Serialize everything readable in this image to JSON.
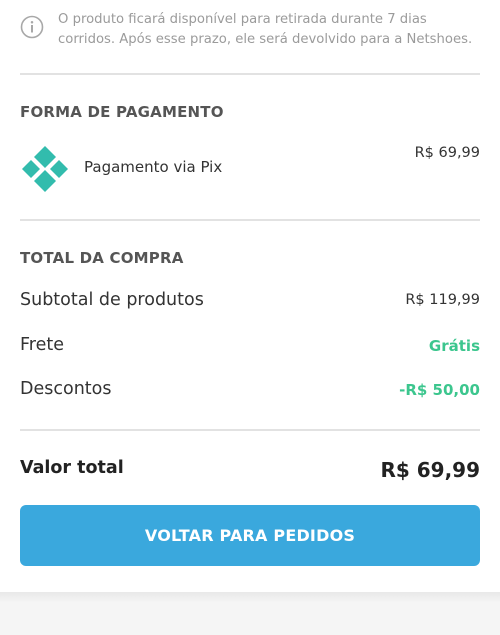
{
  "notice": {
    "icon": "info-icon",
    "text": "O produto ficará disponível para retirada durante 7 dias corridos. Após esse prazo, ele será devolvido para a Netshoes."
  },
  "payment": {
    "title": "FORMA DE PAGAMENTO",
    "method_icon": "pix-icon",
    "method_label": "Pagamento via Pix",
    "amount": "R$ 69,99"
  },
  "summary": {
    "title": "TOTAL DA COMPRA",
    "subtotal_label": "Subtotal de produtos",
    "subtotal_value": "R$ 119,99",
    "shipping_label": "Frete",
    "shipping_value": "Grátis",
    "discount_label": "Descontos",
    "discount_value": "-R$ 50,00",
    "total_label": "Valor total",
    "total_value": "R$ 69,99"
  },
  "actions": {
    "back_label": "VOLTAR PARA PEDIDOS"
  },
  "colors": {
    "primary": "#3aa8dd",
    "success": "#3cc68e",
    "pix": "#32bcad"
  }
}
